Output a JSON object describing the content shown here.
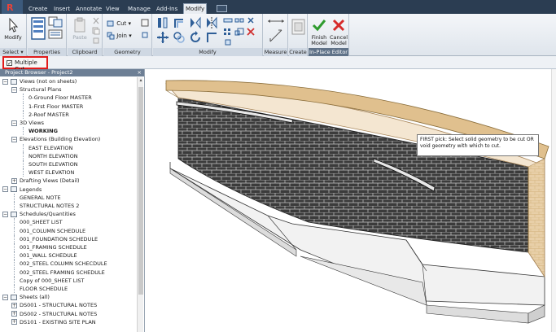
{
  "ribbon_tabs": [
    "Create",
    "Insert",
    "Annotate",
    "View",
    "Manage",
    "Add-Ins",
    "Modify"
  ],
  "active_tab": "Modify",
  "ribbon": {
    "select": {
      "modify_label": "Modify",
      "panel_label": "Select ▾"
    },
    "properties": {
      "panel_label": "Properties"
    },
    "clipboard": {
      "paste_label": "Paste",
      "panel_label": "Clipboard"
    },
    "geometry": {
      "cut_label": "Cut",
      "join_label": "Join",
      "panel_label": "Geometry"
    },
    "modify": {
      "panel_label": "Modify"
    },
    "measure": {
      "panel_label": "Measure"
    },
    "create": {
      "panel_label": "Create"
    },
    "inplace": {
      "finish_label": "Finish Model",
      "cancel_label": "Cancel Model",
      "panel_label": "In-Place Editor"
    }
  },
  "options_bar": {
    "multiple_cut_label": "Multiple Cut",
    "multiple_cut_checked": true
  },
  "browser": {
    "title": "Project Browser - Project2",
    "close": "×",
    "tree": [
      {
        "label": "Views (not on sheets)",
        "level": 0,
        "toggle": "−",
        "icon": true
      },
      {
        "label": "Structural Plans",
        "level": 1,
        "toggle": "−"
      },
      {
        "label": "0-Ground Floor MASTER",
        "level": 2
      },
      {
        "label": "1-First Floor MASTER",
        "level": 2
      },
      {
        "label": "2-Roof MASTER",
        "level": 2
      },
      {
        "label": "3D Views",
        "level": 1,
        "toggle": "−"
      },
      {
        "label": "WORKING",
        "level": 2,
        "bold": true
      },
      {
        "label": "Elevations (Building Elevation)",
        "level": 1,
        "toggle": "−"
      },
      {
        "label": "EAST ELEVATION",
        "level": 2
      },
      {
        "label": "NORTH ELEVATION",
        "level": 2
      },
      {
        "label": "SOUTH  ELEVATION",
        "level": 2
      },
      {
        "label": "WEST ELEVATION",
        "level": 2
      },
      {
        "label": "Drafting Views (Detail)",
        "level": 1,
        "toggle": "+"
      },
      {
        "label": "Legends",
        "level": 0,
        "toggle": "−",
        "icon": true
      },
      {
        "label": "GENERAL NOTE",
        "level": 1
      },
      {
        "label": "STRUCTURAL NOTES 2",
        "level": 1
      },
      {
        "label": "Schedules/Quantities",
        "level": 0,
        "toggle": "−",
        "icon": true
      },
      {
        "label": "000_SHEET LIST",
        "level": 1
      },
      {
        "label": "001_COLUMN SCHEDULE",
        "level": 1
      },
      {
        "label": "001_FOUNDATION SCHEDULE",
        "level": 1
      },
      {
        "label": "001_FRAMING SCHEDULE",
        "level": 1
      },
      {
        "label": "001_WALL SCHEDULE",
        "level": 1
      },
      {
        "label": "002_STEEL COLUMN SCHECDULE",
        "level": 1
      },
      {
        "label": "002_STEEL FRAMING SCHEDULE",
        "level": 1
      },
      {
        "label": "Copy of 000_SHEET LIST",
        "level": 1
      },
      {
        "label": "FLOOR SCHEDULE",
        "level": 1
      },
      {
        "label": "Sheets (all)",
        "level": 0,
        "toggle": "−",
        "icon": true
      },
      {
        "label": "DS001 - STRUCTURAL NOTES",
        "level": 1,
        "toggle": "+"
      },
      {
        "label": "DS002 - STRUCTURAL NOTES",
        "level": 1,
        "toggle": "+"
      },
      {
        "label": "DS101 - EXISTING SITE PLAN",
        "level": 1,
        "toggle": "+"
      }
    ]
  },
  "tooltip": {
    "text": "FIRST pick: Select solid geometry to be cut OR void geometry with which to cut."
  },
  "colors": {
    "ribbon_dark": "#2b3d52",
    "highlight_red": "#e21b1b",
    "brick": "#3a3a3a",
    "mass": "#e6c79a"
  }
}
